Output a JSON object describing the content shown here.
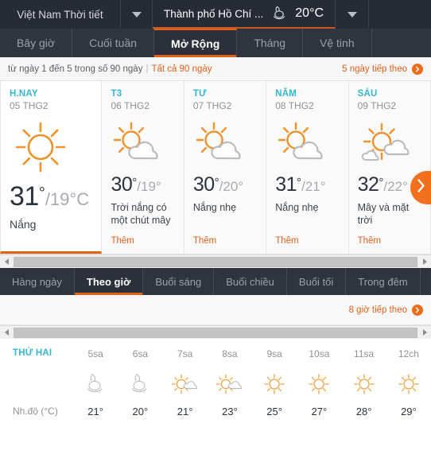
{
  "topbar": {
    "country": "Việt Nam Thời tiết",
    "city": "Thành phố Hồ Chí ...",
    "city_icon": "moon-cloud-icon",
    "temperature": "20°C",
    "caret_icon": "chevron-down-icon"
  },
  "tabs": [
    {
      "label": "Bây giờ",
      "active": false
    },
    {
      "label": "Cuối tuần",
      "active": false
    },
    {
      "label": "Mở Rộng",
      "active": true
    },
    {
      "label": "Tháng",
      "active": false
    },
    {
      "label": "Vệ tinh",
      "active": false
    }
  ],
  "rangebar": {
    "text": "từ ngày 1 đến 5 trong số 90 ngày",
    "separator": "|",
    "all_link": "Tất cả 90 ngày",
    "next_link": "5 ngày tiếp theo",
    "next_icon": "arrow-right-circle-icon"
  },
  "days": [
    {
      "name": "H.NAY",
      "date": "05 THG2",
      "icon": "sun-icon",
      "high": "31",
      "deg": "°",
      "low": "/19°C",
      "desc": "Nắng",
      "more": "",
      "today": true
    },
    {
      "name": "T3",
      "date": "06 THG2",
      "icon": "sun-cloud-icon",
      "high": "30",
      "deg": "°",
      "low": "/19°",
      "desc": "Trời nắng có một chút mây",
      "more": "Thêm",
      "today": false
    },
    {
      "name": "TƯ",
      "date": "07 THG2",
      "icon": "sun-cloud-icon",
      "high": "30",
      "deg": "°",
      "low": "/20°",
      "desc": "Nắng nhẹ",
      "more": "Thêm",
      "today": false
    },
    {
      "name": "NĂM",
      "date": "08 THG2",
      "icon": "sun-cloud-icon",
      "high": "31",
      "deg": "°",
      "low": "/21°",
      "desc": "Nắng nhẹ",
      "more": "Thêm",
      "today": false
    },
    {
      "name": "SÁU",
      "date": "09 THG2",
      "icon": "sun-clouds-icon",
      "high": "32",
      "deg": "°",
      "low": "/22°",
      "desc": "Mây và mặt trời",
      "more": "Thêm",
      "today": false
    }
  ],
  "next_day_button": "chevron-right-icon",
  "subtabs": [
    {
      "label": "Hàng ngày",
      "active": false
    },
    {
      "label": "Theo giờ",
      "active": true
    },
    {
      "label": "Buổi sáng",
      "active": false
    },
    {
      "label": "Buổi chiều",
      "active": false
    },
    {
      "label": "Buổi tối",
      "active": false
    },
    {
      "label": "Trong đêm",
      "active": false
    }
  ],
  "hourbar": {
    "next_link": "8 giờ tiếp theo",
    "next_icon": "arrow-right-circle-icon"
  },
  "hourly": {
    "day_label": "THỨ HAI",
    "temp_label": "Nh.độ (°C)",
    "hours": [
      {
        "time": "5sa",
        "icon": "moon-cloud-icon",
        "temp": "21°"
      },
      {
        "time": "6sa",
        "icon": "moon-cloud-icon",
        "temp": "20°"
      },
      {
        "time": "7sa",
        "icon": "sun-smallcloud-icon",
        "temp": "21°"
      },
      {
        "time": "8sa",
        "icon": "sun-smallcloud-icon",
        "temp": "23°"
      },
      {
        "time": "9sa",
        "icon": "sun-icon",
        "temp": "25°"
      },
      {
        "time": "10sa",
        "icon": "sun-icon",
        "temp": "27°"
      },
      {
        "time": "11sa",
        "icon": "sun-icon",
        "temp": "28°"
      },
      {
        "time": "12ch",
        "icon": "sun-icon",
        "temp": "29°"
      }
    ]
  },
  "scrollbars": {
    "left_icon": "triangle-left-icon",
    "right_icon": "triangle-right-icon"
  },
  "colors": {
    "accent": "#e2601a",
    "dark_bar": "#2f343f",
    "day_name": "#35b6d4",
    "sun": "#f0922b"
  }
}
